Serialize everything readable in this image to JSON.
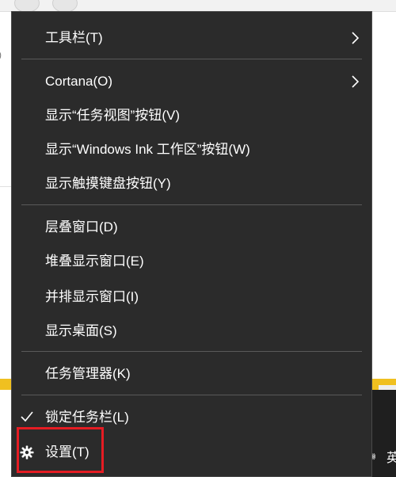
{
  "menu": {
    "items": [
      {
        "label": "工具栏(T)",
        "has_submenu": true
      },
      {
        "label": "Cortana(O)",
        "has_submenu": true
      },
      {
        "label": "显示“任务视图”按钮(V)"
      },
      {
        "label": "显示“Windows Ink 工作区”按钮(W)"
      },
      {
        "label": "显示触摸键盘按钮(Y)"
      },
      {
        "label": "层叠窗口(D)"
      },
      {
        "label": "堆叠显示窗口(E)"
      },
      {
        "label": "并排显示窗口(I)"
      },
      {
        "label": "显示桌面(S)"
      },
      {
        "label": "任务管理器(K)"
      },
      {
        "label": "锁定任务栏(L)",
        "checked": true
      },
      {
        "label": "设置(T)",
        "icon": "gear-icon"
      }
    ]
  },
  "tray": {
    "ime_label": "英",
    "speaker_icon": "speaker-icon"
  },
  "colors": {
    "menu_bg": "#2b2b2b",
    "menu_text": "#ffffff",
    "separator": "#5a5a5a",
    "highlight_border": "#e51c23",
    "desktop_accent": "#f0c020"
  }
}
